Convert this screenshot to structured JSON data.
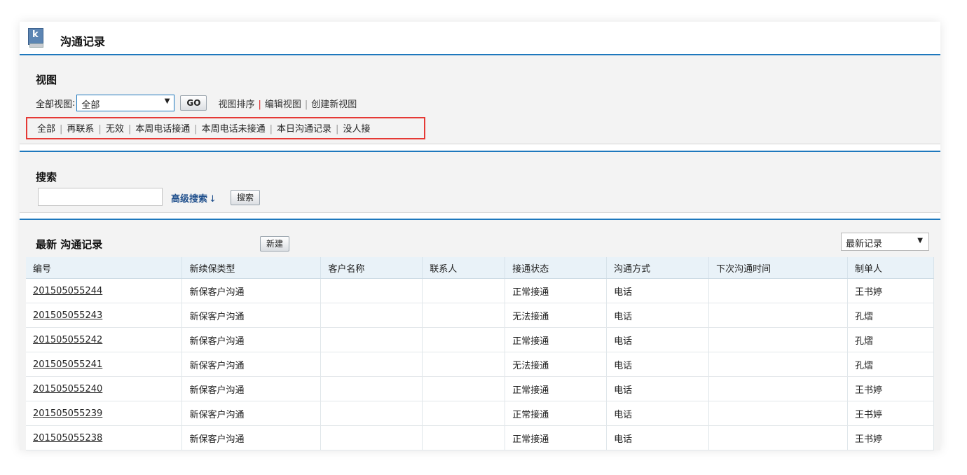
{
  "header": {
    "title": "沟通记录"
  },
  "view": {
    "title": "视图",
    "label": "全部视图",
    "selected": "全部",
    "go_label": "GO",
    "links": [
      "视图排序",
      "编辑视图",
      "创建新视图"
    ],
    "filters": [
      "全部",
      "再联系",
      "无效",
      "本周电话接通",
      "本周电话未接通",
      "本日沟通记录",
      "没人接"
    ]
  },
  "search": {
    "title": "搜索",
    "input_value": "",
    "advanced_label": "高级搜索",
    "advanced_arrow": "↓",
    "button_label": "搜索"
  },
  "list": {
    "title": "最新 沟通记录",
    "new_label": "新建",
    "sort_selected": "最新记录",
    "columns": [
      "编号",
      "新续保类型",
      "客户名称",
      "联系人",
      "接通状态",
      "沟通方式",
      "下次沟通时间",
      "制单人"
    ],
    "rows": [
      {
        "id": "201505055244",
        "type": "新保客户沟通",
        "customer": "",
        "contact": "",
        "status": "正常接通",
        "method": "电话",
        "next": "",
        "creator": "王书婷"
      },
      {
        "id": "201505055243",
        "type": "新保客户沟通",
        "customer": "",
        "contact": "",
        "status": "无法接通",
        "method": "电话",
        "next": "",
        "creator": "孔熠"
      },
      {
        "id": "201505055242",
        "type": "新保客户沟通",
        "customer": "",
        "contact": "",
        "status": "正常接通",
        "method": "电话",
        "next": "",
        "creator": "孔熠"
      },
      {
        "id": "201505055241",
        "type": "新保客户沟通",
        "customer": "",
        "contact": "",
        "status": "无法接通",
        "method": "电话",
        "next": "",
        "creator": "孔熠"
      },
      {
        "id": "201505055240",
        "type": "新保客户沟通",
        "customer": "",
        "contact": "",
        "status": "正常接通",
        "method": "电话",
        "next": "",
        "creator": "王书婷"
      },
      {
        "id": "201505055239",
        "type": "新保客户沟通",
        "customer": "",
        "contact": "",
        "status": "正常接通",
        "method": "电话",
        "next": "",
        "creator": "王书婷"
      },
      {
        "id": "201505055238",
        "type": "新保客户沟通",
        "customer": "",
        "contact": "",
        "status": "正常接通",
        "method": "电话",
        "next": "",
        "creator": "王书婷"
      }
    ]
  },
  "colors": {
    "accent": "#1e78bd",
    "highlight": "#e53935",
    "header_bg": "#e9f2f8"
  }
}
